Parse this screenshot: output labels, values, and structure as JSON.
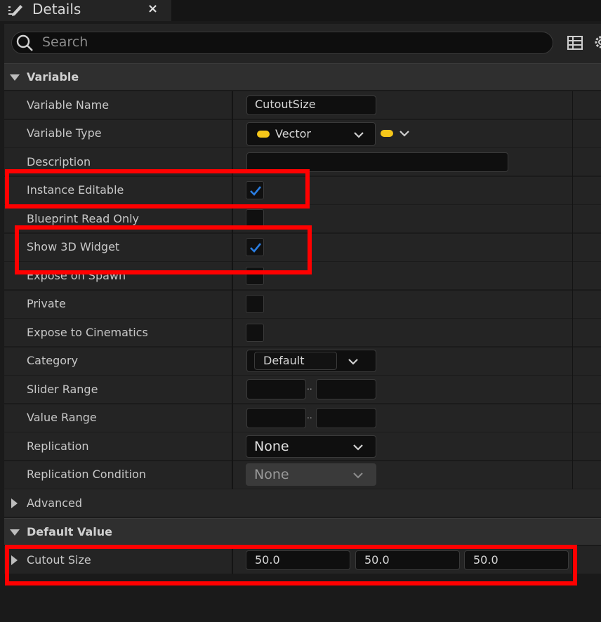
{
  "tab": {
    "title": "Details",
    "close": "×",
    "icon": "pencil-document-icon"
  },
  "search": {
    "placeholder": "Search"
  },
  "toolbar": {
    "table_icon": "table-icon",
    "settings_icon": "gear-icon"
  },
  "sections": {
    "variable": "Variable",
    "advanced": "Advanced",
    "default_value": "Default Value"
  },
  "variable": {
    "name_label": "Variable Name",
    "name_value": "CutoutSize",
    "type_label": "Variable Type",
    "type_value": "Vector",
    "description_label": "Description",
    "description_value": "",
    "instance_editable_label": "Instance Editable",
    "instance_editable": true,
    "blueprint_read_only_label": "Blueprint Read Only",
    "blueprint_read_only": false,
    "show_3d_widget_label": "Show 3D Widget",
    "show_3d_widget": true,
    "expose_on_spawn_label": "Expose on Spawn",
    "expose_on_spawn": false,
    "private_label": "Private",
    "private": false,
    "expose_to_cinematics_label": "Expose to Cinematics",
    "expose_to_cinematics": false,
    "category_label": "Category",
    "category_value": "Default",
    "slider_range_label": "Slider Range",
    "slider_range_min": "",
    "slider_range_max": "",
    "value_range_label": "Value Range",
    "value_range_min": "",
    "value_range_max": "",
    "range_separator": "..",
    "replication_label": "Replication",
    "replication_value": "None",
    "replication_condition_label": "Replication Condition",
    "replication_condition_value": "None"
  },
  "default_value": {
    "cutout_size_label": "Cutout Size",
    "x": "50.0",
    "y": "50.0",
    "z": "50.0"
  },
  "colors": {
    "accent_check": "#2a7de1",
    "vector_pin": "#f6c71a",
    "highlight": "#ff0000"
  }
}
